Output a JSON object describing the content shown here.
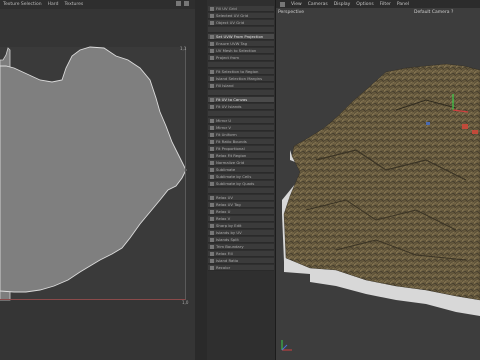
{
  "uv_editor": {
    "menu": [
      "Texture Selection",
      "Hard",
      "Textures"
    ],
    "axis_top_label": "1,1",
    "axis_bottom_label": "1,0"
  },
  "command_palette": {
    "items": [
      {
        "label": "Fill UV Grid"
      },
      {
        "label": "Selected UV Grid"
      },
      {
        "label": "Object UV Grid"
      },
      {
        "label": ""
      },
      {
        "label": "Set UVW From Projection",
        "highlight": true
      },
      {
        "label": "Ensure UVW Tag"
      },
      {
        "label": "UV Mesh to Selection"
      },
      {
        "label": "Project from"
      },
      {
        "label": ""
      },
      {
        "label": "Fit Selection to Region"
      },
      {
        "label": "Island Selection Margins"
      },
      {
        "label": "Fill Island"
      },
      {
        "label": ""
      },
      {
        "label": "Fit UV to Canvas",
        "highlight": true
      },
      {
        "label": "Fit UV Islands"
      },
      {
        "label": ""
      },
      {
        "label": "Mirror U"
      },
      {
        "label": "Mirror V"
      },
      {
        "label": "Fit Uniform"
      },
      {
        "label": "Fit Ratio Bounds"
      },
      {
        "label": "Fit Proportional"
      },
      {
        "label": "Relax Fit Region"
      },
      {
        "label": "Normalize Grid"
      },
      {
        "label": "Sublimate"
      },
      {
        "label": "Sublimate by Cells"
      },
      {
        "label": "Sublimate by Quads"
      },
      {
        "label": ""
      },
      {
        "label": "Relax UV"
      },
      {
        "label": "Relax UV Tag"
      },
      {
        "label": "Relax U"
      },
      {
        "label": "Relax V"
      },
      {
        "label": "Sharp by Edit"
      },
      {
        "label": "Islands by UV"
      },
      {
        "label": "Islands Split"
      },
      {
        "label": "Trim Boundary"
      },
      {
        "label": "Relax Fill"
      },
      {
        "label": "Island Ratio"
      },
      {
        "label": "Recolor"
      }
    ]
  },
  "viewport": {
    "menu": [
      "View",
      "Cameras",
      "Display",
      "Options",
      "Filter",
      "Panel"
    ],
    "title": "Perspective",
    "camera": "Default Camera ?"
  },
  "colors": {
    "uv_shape": "#7d7d7d",
    "terrain_dark": "#4a4332",
    "terrain_light": "#8a7a56",
    "accent_red": "#c24a3a",
    "axis_green": "#3ccd4a"
  }
}
